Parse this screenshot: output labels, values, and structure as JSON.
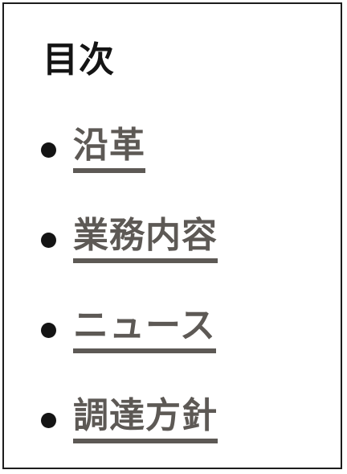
{
  "toc": {
    "title": "目次",
    "items": [
      {
        "label": "沿革"
      },
      {
        "label": "業務内容"
      },
      {
        "label": "ニュース"
      },
      {
        "label": "調達方針"
      }
    ]
  },
  "colors": {
    "text_dark": "#141414",
    "link": "#5d5955",
    "border": "#1c1c1c",
    "background": "#ffffff"
  }
}
